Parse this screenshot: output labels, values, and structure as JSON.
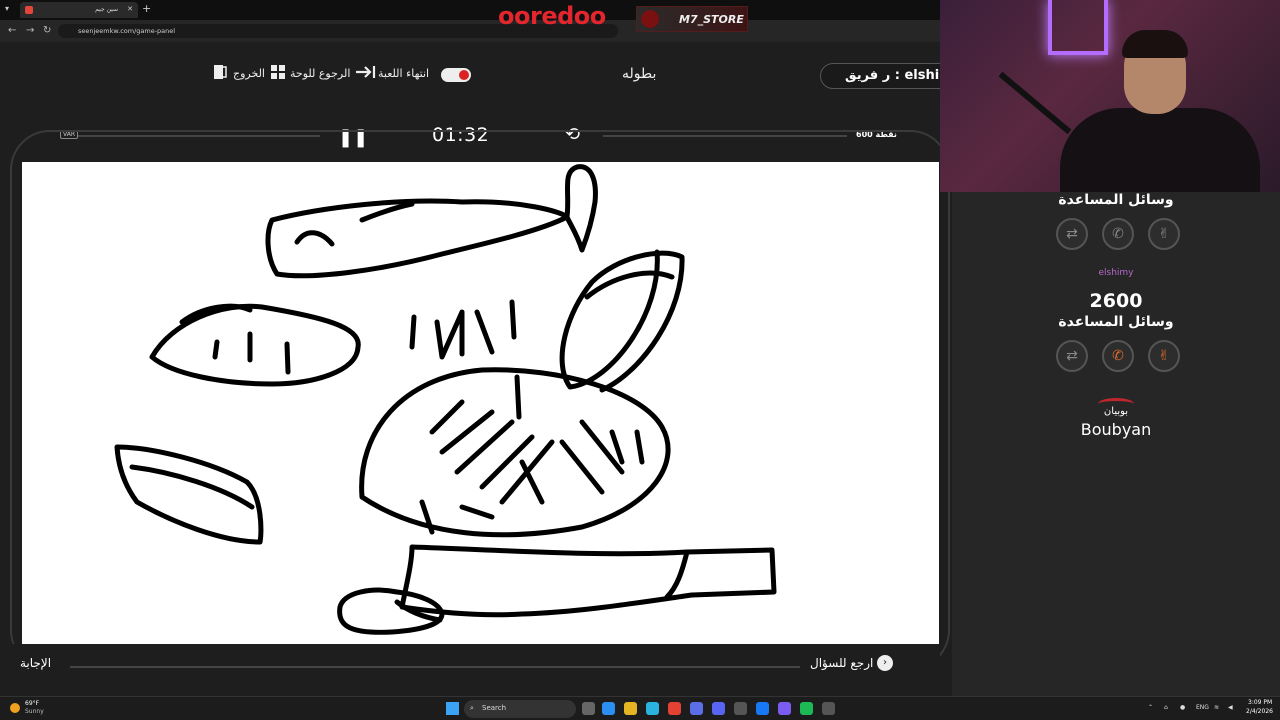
{
  "browser": {
    "tab_title": "سين جيم",
    "url": "seenjeemkw.com/game-panel"
  },
  "sponsors": {
    "ooredoo": "ooredoo",
    "m7_store": "M7_STORE",
    "boubyan_ar": "بوبيان",
    "boubyan_en": "Boubyan"
  },
  "header": {
    "exit_label": "الخروج",
    "back_to_board_label": "الرجوع للوحة",
    "end_game_label": "انتهاء اللعبة",
    "title": "بطوله",
    "team_label": "ر فريق : elshimy"
  },
  "timer_row": {
    "var_label": "VAR",
    "time": "01:32",
    "points": "600 نقطة"
  },
  "bottom_bar": {
    "answer_label": "الإجابة",
    "back_to_question_label": "ارجع للسؤال"
  },
  "right_panel": {
    "helpers_title_1": "وسائل المساعدة",
    "team_name": "elshimy",
    "score": "2600",
    "helpers_title_2": "وسائل المساعدة",
    "helper_icons": [
      "two-answers-icon",
      "phone-icon",
      "hand-icon"
    ]
  },
  "taskbar": {
    "temp": "69°F",
    "weather": "Sunny",
    "search_placeholder": "Search",
    "lang": "ENG",
    "time": "3:09 PM",
    "date": "2/4/2026"
  }
}
